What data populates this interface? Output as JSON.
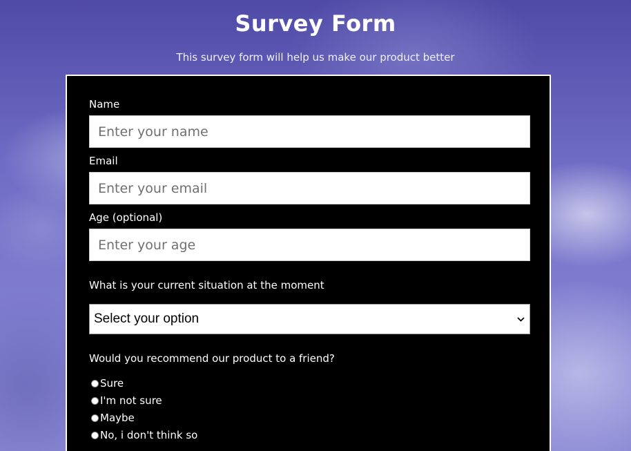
{
  "header": {
    "title": "Survey Form",
    "description": "This survey form will help us make our product better"
  },
  "form": {
    "name": {
      "label": "Name",
      "placeholder": "Enter your name"
    },
    "email": {
      "label": "Email",
      "placeholder": "Enter your email"
    },
    "age": {
      "label": "Age (optional)",
      "placeholder": "Enter your age"
    },
    "situation": {
      "label": "What is your current situation at the moment",
      "selected": "Select your option"
    },
    "recommend": {
      "question": "Would you recommend our product to a friend?",
      "options": [
        "Sure",
        "I'm not sure",
        "Maybe",
        "No, i don't think so"
      ]
    }
  }
}
